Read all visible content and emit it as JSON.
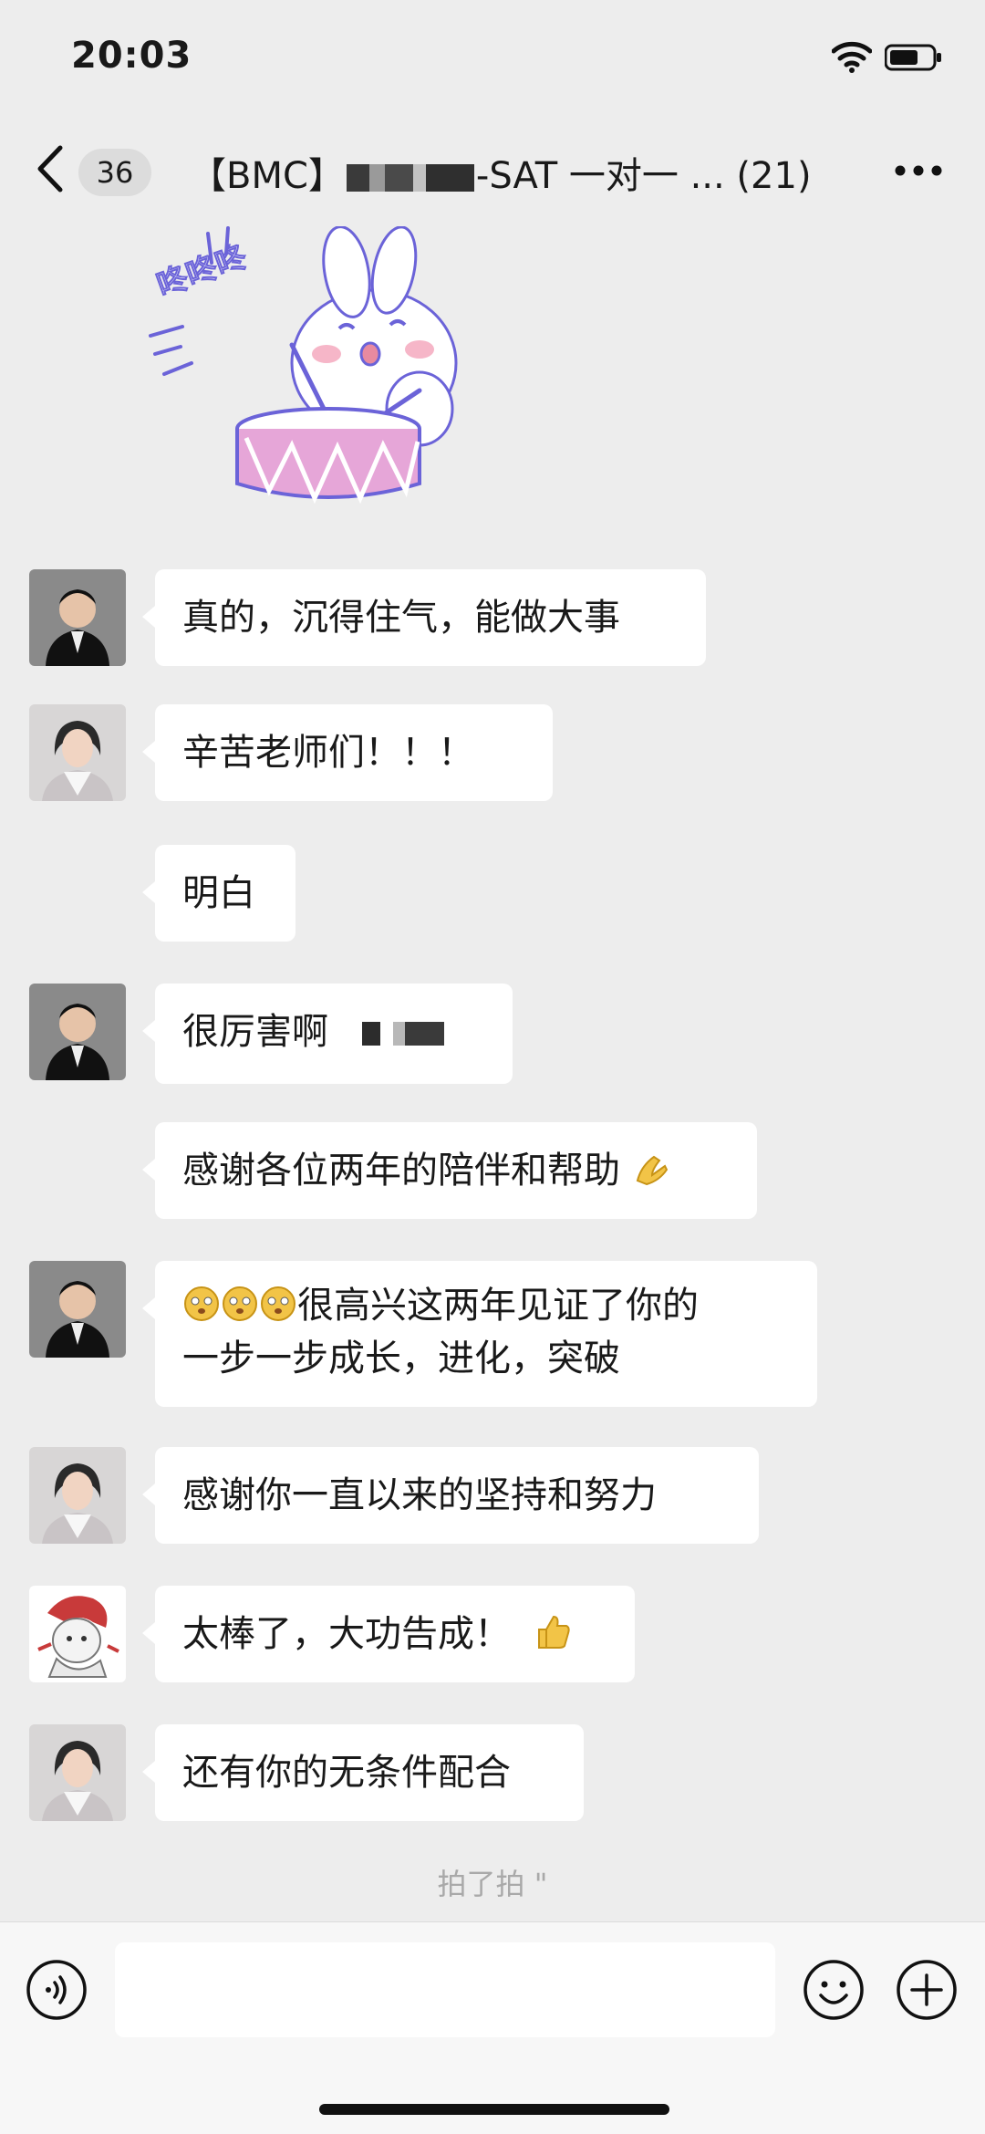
{
  "status_bar": {
    "time": "20:03"
  },
  "header": {
    "back_count": "36",
    "title_prefix": "【BMC】",
    "title_suffix": "-SAT 一对一 ... (21)"
  },
  "messages": [
    {
      "sender": "teacher-male",
      "text": "真的，沉得住气，能做大事"
    },
    {
      "sender": "teacher-female",
      "text": "辛苦老师们！！！"
    },
    {
      "sender": "none",
      "text": "明白"
    },
    {
      "sender": "teacher-male",
      "text": "很厉害啊"
    },
    {
      "sender": "none",
      "text": "感谢各位两年的陪伴和帮助"
    },
    {
      "sender": "teacher-male",
      "text": "很高兴这两年见证了你的",
      "text2": "一步一步成长，进化，突破"
    },
    {
      "sender": "teacher-female",
      "text": "感谢你一直以来的坚持和努力"
    },
    {
      "sender": "cartoon",
      "text": "太棒了，大功告成！"
    },
    {
      "sender": "teacher-female",
      "text": "还有你的无条件配合"
    }
  ],
  "system_message": "拍了拍 \"",
  "sticker": {
    "caption": "咚咚咚"
  },
  "colors": {
    "background": "#ededed",
    "bubble": "#ffffff",
    "sticker_purple": "#6b63d8",
    "sticker_pink": "#e6a6d8"
  }
}
